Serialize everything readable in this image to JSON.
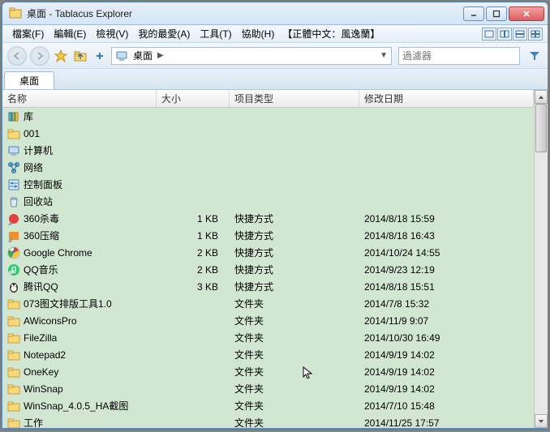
{
  "title": "桌面 - Tablacus Explorer",
  "menus": [
    "檔案(F)",
    "編輯(E)",
    "檢視(V)",
    "我的最愛(A)",
    "工具(T)",
    "協助(H)"
  ],
  "menu_extra": "【正體中文：風逸蘭】",
  "breadcrumb": {
    "location": "桌面"
  },
  "filter_placeholder": "過濾器",
  "tab": {
    "label": "桌面"
  },
  "columns": {
    "name": "名称",
    "size": "大小",
    "type": "项目类型",
    "date": "修改日期"
  },
  "rows": [
    {
      "icon": "library",
      "name": "库",
      "size": "",
      "type": "",
      "date": ""
    },
    {
      "icon": "folder",
      "name": "001",
      "size": "",
      "type": "",
      "date": ""
    },
    {
      "icon": "computer",
      "name": "计算机",
      "size": "",
      "type": "",
      "date": ""
    },
    {
      "icon": "network",
      "name": "网络",
      "size": "",
      "type": "",
      "date": ""
    },
    {
      "icon": "control",
      "name": "控制面板",
      "size": "",
      "type": "",
      "date": ""
    },
    {
      "icon": "recycle",
      "name": "回收站",
      "size": "",
      "type": "",
      "date": ""
    },
    {
      "icon": "shortcut-red",
      "name": "360杀毒",
      "size": "1 KB",
      "type": "快捷方式",
      "date": "2014/8/18 15:59"
    },
    {
      "icon": "shortcut-orange",
      "name": "360压缩",
      "size": "1 KB",
      "type": "快捷方式",
      "date": "2014/8/18 16:43"
    },
    {
      "icon": "chrome",
      "name": "Google Chrome",
      "size": "2 KB",
      "type": "快捷方式",
      "date": "2014/10/24 14:55"
    },
    {
      "icon": "music",
      "name": "QQ音乐",
      "size": "2 KB",
      "type": "快捷方式",
      "date": "2014/9/23 12:19"
    },
    {
      "icon": "qq",
      "name": "腾讯QQ",
      "size": "3 KB",
      "type": "快捷方式",
      "date": "2014/8/18 15:51"
    },
    {
      "icon": "folder",
      "name": "073图文排版工具1.0",
      "size": "",
      "type": "文件夹",
      "date": "2014/7/8 15:32"
    },
    {
      "icon": "folder",
      "name": "AWiconsPro",
      "size": "",
      "type": "文件夹",
      "date": "2014/11/9 9:07"
    },
    {
      "icon": "folder",
      "name": "FileZilla",
      "size": "",
      "type": "文件夹",
      "date": "2014/10/30 16:49"
    },
    {
      "icon": "folder",
      "name": "Notepad2",
      "size": "",
      "type": "文件夹",
      "date": "2014/9/19 14:02"
    },
    {
      "icon": "folder",
      "name": "OneKey",
      "size": "",
      "type": "文件夹",
      "date": "2014/9/19 14:02",
      "cursor": true
    },
    {
      "icon": "folder",
      "name": "WinSnap",
      "size": "",
      "type": "文件夹",
      "date": "2014/9/19 14:02"
    },
    {
      "icon": "folder",
      "name": "WinSnap_4.0.5_HA截图",
      "size": "",
      "type": "文件夹",
      "date": "2014/7/10 15:48"
    },
    {
      "icon": "folder",
      "name": "工作",
      "size": "",
      "type": "文件夹",
      "date": "2014/11/25 17:57"
    }
  ]
}
